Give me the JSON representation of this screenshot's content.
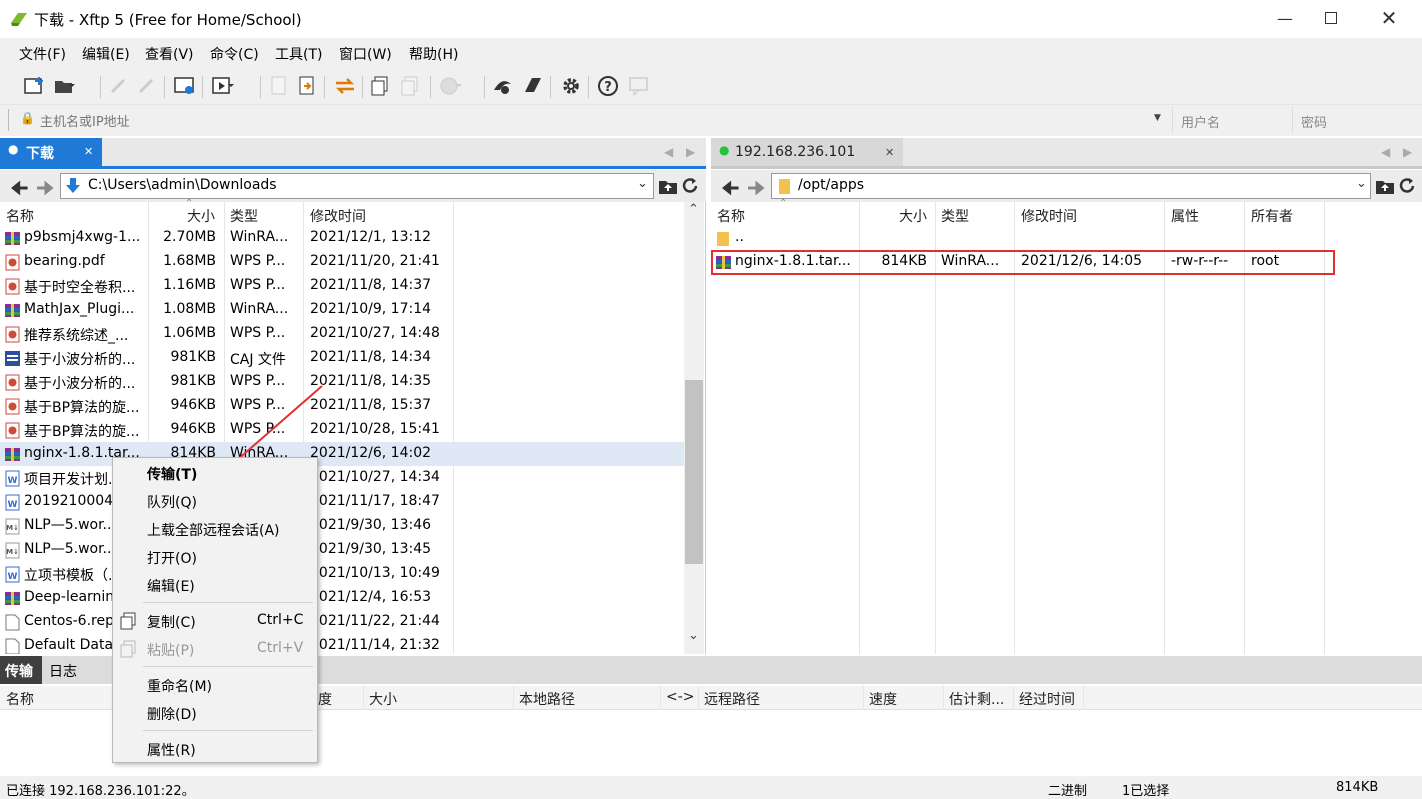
{
  "window": {
    "title": "下载 - Xftp 5 (Free for Home/School)"
  },
  "menu": [
    "文件(F)",
    "编辑(E)",
    "查看(V)",
    "命令(C)",
    "工具(T)",
    "窗口(W)",
    "帮助(H)"
  ],
  "address": {
    "host_placeholder": "主机名或IP地址",
    "user_placeholder": "用户名",
    "password_placeholder": "密码"
  },
  "local": {
    "tab_label": "下载",
    "path": "C:\\Users\\admin\\Downloads",
    "columns": [
      "名称",
      "大小",
      "类型",
      "修改时间"
    ],
    "files": [
      {
        "name": "p9bsmj4xwg-1...",
        "size": "2.70MB",
        "type": "WinRA...",
        "modified": "2021/12/1, 13:12",
        "icon": "rar-icon"
      },
      {
        "name": "bearing.pdf",
        "size": "1.68MB",
        "type": "WPS P...",
        "modified": "2021/11/20, 21:41",
        "icon": "pdf-icon"
      },
      {
        "name": "基于时空全卷积...",
        "size": "1.16MB",
        "type": "WPS P...",
        "modified": "2021/11/8, 14:37",
        "icon": "pdf-icon"
      },
      {
        "name": "MathJax_Plugi...",
        "size": "1.08MB",
        "type": "WinRA...",
        "modified": "2021/10/9, 17:14",
        "icon": "rar-icon"
      },
      {
        "name": "推荐系统综述_...",
        "size": "1.06MB",
        "type": "WPS P...",
        "modified": "2021/10/27, 14:48",
        "icon": "pdf-icon"
      },
      {
        "name": "基于小波分析的...",
        "size": "981KB",
        "type": "CAJ 文件",
        "modified": "2021/11/8, 14:34",
        "icon": "caj-icon"
      },
      {
        "name": "基于小波分析的...",
        "size": "981KB",
        "type": "WPS P...",
        "modified": "2021/11/8, 14:35",
        "icon": "pdf-icon"
      },
      {
        "name": "基于BP算法的旋...",
        "size": "946KB",
        "type": "WPS P...",
        "modified": "2021/11/8, 15:37",
        "icon": "pdf-icon"
      },
      {
        "name": "基于BP算法的旋...",
        "size": "946KB",
        "type": "WPS P...",
        "modified": "2021/10/28, 15:41",
        "icon": "pdf-icon"
      },
      {
        "name": "nginx-1.8.1.tar...",
        "size": "814KB",
        "type": "WinRA...",
        "modified": "2021/12/6, 14:02",
        "icon": "rar-icon"
      },
      {
        "name": "项目开发计划...",
        "size": "",
        "type": "",
        "modified": "2021/10/27, 14:34",
        "icon": "doc-icon"
      },
      {
        "name": "20192100041...",
        "size": "",
        "type": "",
        "modified": "2021/11/17, 18:47",
        "icon": "doc-icon"
      },
      {
        "name": "NLP—5.wor...",
        "size": "",
        "type": "",
        "modified": "2021/9/30, 13:46",
        "icon": "md-icon"
      },
      {
        "name": "NLP—5.wor...",
        "size": "",
        "type": "",
        "modified": "2021/9/30, 13:45",
        "icon": "md-icon"
      },
      {
        "name": "立项书模板（...",
        "size": "",
        "type": "",
        "modified": "2021/10/13, 10:49",
        "icon": "doc-icon"
      },
      {
        "name": "Deep-learnin...",
        "size": "",
        "type": "",
        "modified": "2021/12/4, 16:53",
        "icon": "rar-icon"
      },
      {
        "name": "Centos-6.rep...",
        "size": "",
        "type": "",
        "modified": "2021/11/22, 21:44",
        "icon": "file-icon"
      },
      {
        "name": "Default Data...",
        "size": "",
        "type": "",
        "modified": "2021/11/14, 21:32",
        "icon": "file-icon"
      }
    ]
  },
  "remote": {
    "tab_label": "192.168.236.101",
    "path": "/opt/apps",
    "columns": [
      "名称",
      "大小",
      "类型",
      "修改时间",
      "属性",
      "所有者"
    ],
    "parent": "..",
    "files": [
      {
        "name": "nginx-1.8.1.tar...",
        "size": "814KB",
        "type": "WinRA...",
        "modified": "2021/12/6, 14:05",
        "attr": "-rw-r--r--",
        "owner": "root"
      }
    ]
  },
  "bottom": {
    "tabs": [
      "传输",
      "日志"
    ],
    "columns": [
      "名称",
      "度",
      "大小",
      "本地路径",
      "<->",
      "远程路径",
      "速度",
      "估计剩...",
      "经过时间"
    ]
  },
  "context_menu": {
    "items": [
      {
        "label": "传输(T)",
        "shortcut": ""
      },
      {
        "label": "队列(Q)",
        "shortcut": ""
      },
      {
        "label": "上载全部远程会话(A)",
        "shortcut": ""
      },
      {
        "label": "打开(O)",
        "shortcut": ""
      },
      {
        "label": "编辑(E)",
        "shortcut": ""
      },
      {
        "label": "复制(C)",
        "shortcut": "Ctrl+C"
      },
      {
        "label": "粘贴(P)",
        "shortcut": "Ctrl+V"
      },
      {
        "label": "重命名(M)",
        "shortcut": ""
      },
      {
        "label": "删除(D)",
        "shortcut": ""
      },
      {
        "label": "属性(R)",
        "shortcut": ""
      }
    ]
  },
  "status": {
    "left": "已连接 192.168.236.101:22。",
    "mode": "二进制",
    "selection": "1已选择",
    "size": "814KB"
  },
  "colors": {
    "accent": "#1e7ad6",
    "highlight_box": "#e0312f",
    "connected_dot": "#27c23a"
  }
}
